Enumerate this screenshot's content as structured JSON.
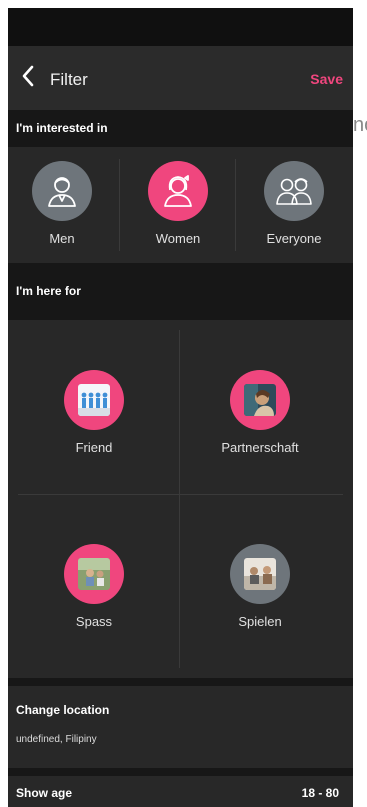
{
  "header": {
    "title": "Filter",
    "save_label": "Save"
  },
  "interested": {
    "title": "I'm interested in",
    "options": [
      {
        "label": "Men",
        "icon": "man-icon",
        "selected": false
      },
      {
        "label": "Women",
        "icon": "woman-icon",
        "selected": true
      },
      {
        "label": "Everyone",
        "icon": "people-icon",
        "selected": false
      }
    ]
  },
  "here_for": {
    "title": "I'm here for",
    "options": [
      {
        "label": "Friend",
        "icon": "friend-photo-icon",
        "selected": true
      },
      {
        "label": "Partnerschaft",
        "icon": "partnership-photo-icon",
        "selected": true
      },
      {
        "label": "Spass",
        "icon": "fun-photo-icon",
        "selected": true
      },
      {
        "label": "Spielen",
        "icon": "games-photo-icon",
        "selected": false
      }
    ]
  },
  "location": {
    "title": "Change location",
    "value": "undefined, Filipiny"
  },
  "age": {
    "title": "Show age",
    "value": "18 - 80"
  },
  "background_fragment": "no",
  "colors": {
    "accent": "#f0467e",
    "unselected": "#6e757b",
    "panel": "#282828",
    "section": "#171717"
  }
}
